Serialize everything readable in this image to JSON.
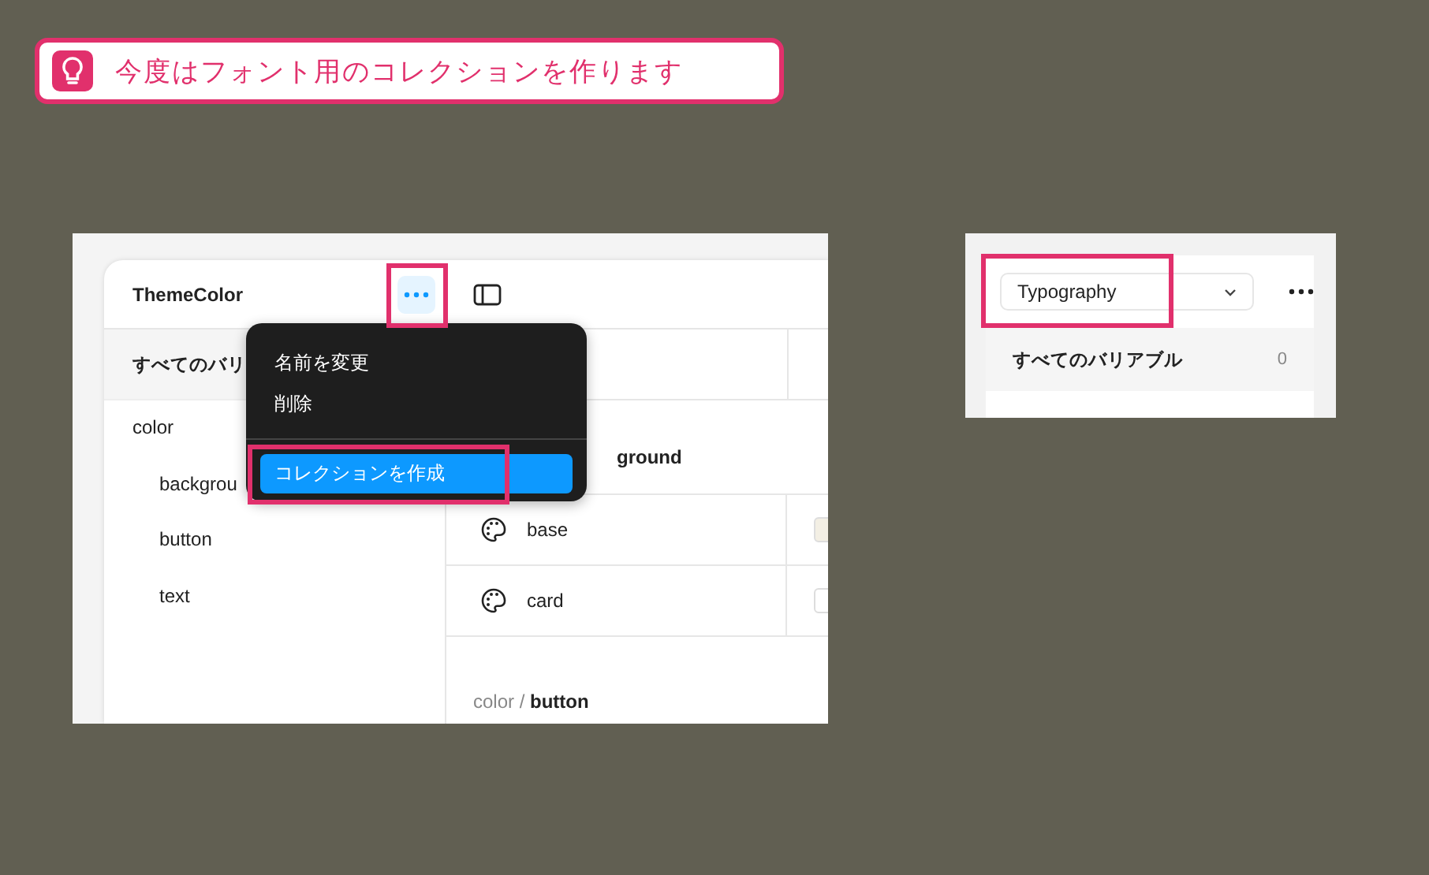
{
  "banner": {
    "text": "今度はフォント用のコレクションを作ります"
  },
  "theme_screen": {
    "collection_title": "ThemeColor",
    "more_button": {
      "highlighted": true
    },
    "left_header": "すべてのバリ",
    "tree": [
      {
        "label": "color",
        "children": [
          {
            "label": "backgrou"
          },
          {
            "label": "button"
          },
          {
            "label": "text"
          }
        ]
      }
    ],
    "menu": [
      {
        "label": "名前を変更",
        "selected": false,
        "highlighted": false
      },
      {
        "label": "削除",
        "selected": false,
        "highlighted": false
      },
      {
        "label": "コレクションを作成",
        "selected": true,
        "highlighted": true
      }
    ],
    "group_heading": "ground",
    "rows": [
      {
        "name": "base",
        "color": "#f3efe4"
      },
      {
        "name": "card",
        "color": "#ffffff"
      }
    ],
    "next_group": "color / **button**"
  },
  "typography_screen": {
    "dropdown": {
      "value": "Typography",
      "highlighted": true
    },
    "all_variables": {
      "label": "すべてのバリアブル",
      "count": "0"
    }
  }
}
